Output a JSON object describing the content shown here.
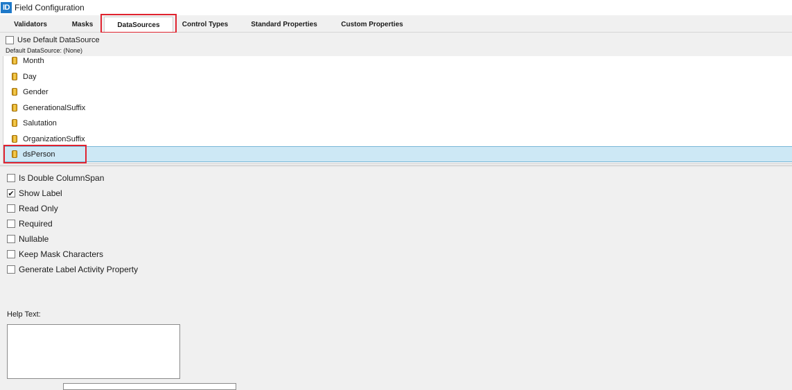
{
  "window": {
    "icon_text": "ID",
    "title": "Field Configuration"
  },
  "tabs": [
    {
      "label": "Validators"
    },
    {
      "label": "Masks"
    },
    {
      "label": "DataSources"
    },
    {
      "label": "Control Types"
    },
    {
      "label": "Standard Properties"
    },
    {
      "label": "Custom Properties"
    }
  ],
  "active_tab": "DataSources",
  "datasource": {
    "use_default_label": "Use Default DataSource",
    "use_default_checked": false,
    "default_text": "Default DataSource: (None)"
  },
  "list": {
    "items": [
      {
        "label": "Month"
      },
      {
        "label": "Day"
      },
      {
        "label": "Gender"
      },
      {
        "label": "GenerationalSuffix"
      },
      {
        "label": "Salutation"
      },
      {
        "label": "OrganizationSuffix"
      },
      {
        "label": "dsPerson"
      }
    ],
    "selected": "dsPerson",
    "item_icon": "database-icon"
  },
  "options": [
    {
      "label": "Is Double ColumnSpan",
      "checked": false
    },
    {
      "label": "Show Label",
      "checked": true
    },
    {
      "label": "Read Only",
      "checked": false
    },
    {
      "label": "Required",
      "checked": false
    },
    {
      "label": "Nullable",
      "checked": false
    },
    {
      "label": "Keep Mask Characters",
      "checked": false
    },
    {
      "label": "Generate Label Activity Property",
      "checked": false
    }
  ],
  "help": {
    "label": "Help Text:",
    "value": ""
  },
  "colors": {
    "accent": "#1e79c9",
    "highlight": "#e0232f",
    "selection": "#cde8f5"
  }
}
